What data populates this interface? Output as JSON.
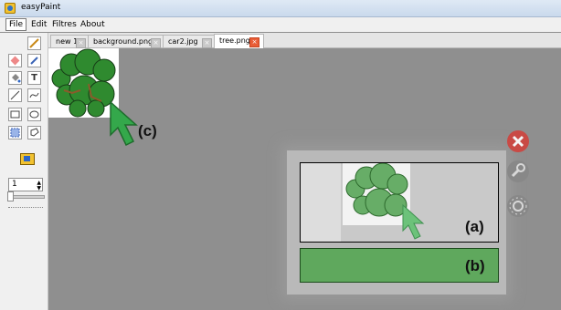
{
  "window": {
    "title": "easyPaint"
  },
  "menu": [
    "File",
    "Edit",
    "Filtres",
    "About"
  ],
  "tabs": [
    {
      "label": "new 1"
    },
    {
      "label": "background.png"
    },
    {
      "label": "car2.jpg"
    },
    {
      "label": "tree.png"
    }
  ],
  "toolbox": {
    "size_value": "1"
  },
  "annotations": {
    "a": "(a)",
    "b": "(b)",
    "c": "(c)"
  },
  "colors": {
    "close_button": "#c94a45",
    "tree_green": "#2f8a2f",
    "bar_green": "#5fa85d"
  }
}
